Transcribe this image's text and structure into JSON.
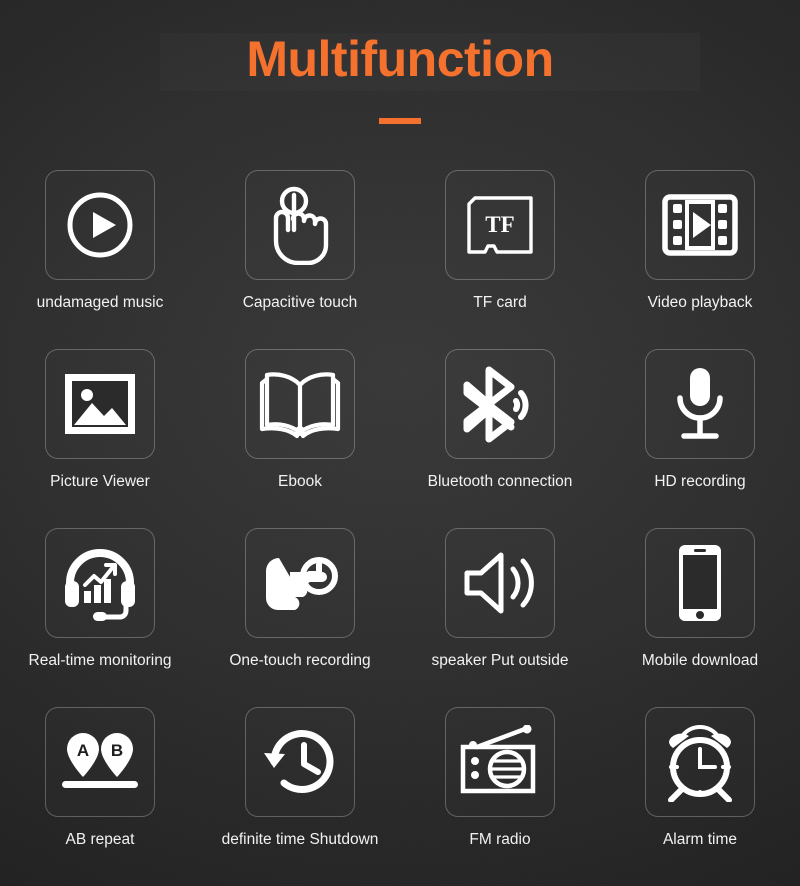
{
  "header": {
    "title": "Multifunction",
    "accent_color": "#f4712e",
    "divider": "rule"
  },
  "theme": {
    "background_color": "#2b2b2b",
    "tile_border_color": "rgba(255,255,255,0.26)",
    "icon_color": "#ffffff",
    "label_color": "#f2f2f2"
  },
  "features": [
    {
      "icon": "play-circle-icon",
      "label": "undamaged music"
    },
    {
      "icon": "capacitive-touch-hand-icon",
      "label": "Capacitive touch"
    },
    {
      "icon": "tf-card-icon",
      "label": "TF card",
      "icon_text": "TF"
    },
    {
      "icon": "film-play-icon",
      "label": "Video playback"
    },
    {
      "icon": "picture-frame-icon",
      "label": "Picture Viewer"
    },
    {
      "icon": "open-book-icon",
      "label": "Ebook"
    },
    {
      "icon": "bluetooth-icon",
      "label": "Bluetooth connection"
    },
    {
      "icon": "microphone-icon",
      "label": "HD recording"
    },
    {
      "icon": "headset-chart-icon",
      "label": "Real-time monitoring"
    },
    {
      "icon": "hand-press-button-icon",
      "label": "One-touch recording"
    },
    {
      "icon": "speaker-waves-icon",
      "label": "speaker Put outside"
    },
    {
      "icon": "smartphone-icon",
      "label": "Mobile download"
    },
    {
      "icon": "ab-repeat-pins-icon",
      "label": "AB repeat",
      "pin_a": "A",
      "pin_b": "B"
    },
    {
      "icon": "clock-rotate-back-icon",
      "label": "definite time Shutdown"
    },
    {
      "icon": "fm-radio-icon",
      "label": "FM radio"
    },
    {
      "icon": "alarm-clock-icon",
      "label": "Alarm time"
    }
  ]
}
